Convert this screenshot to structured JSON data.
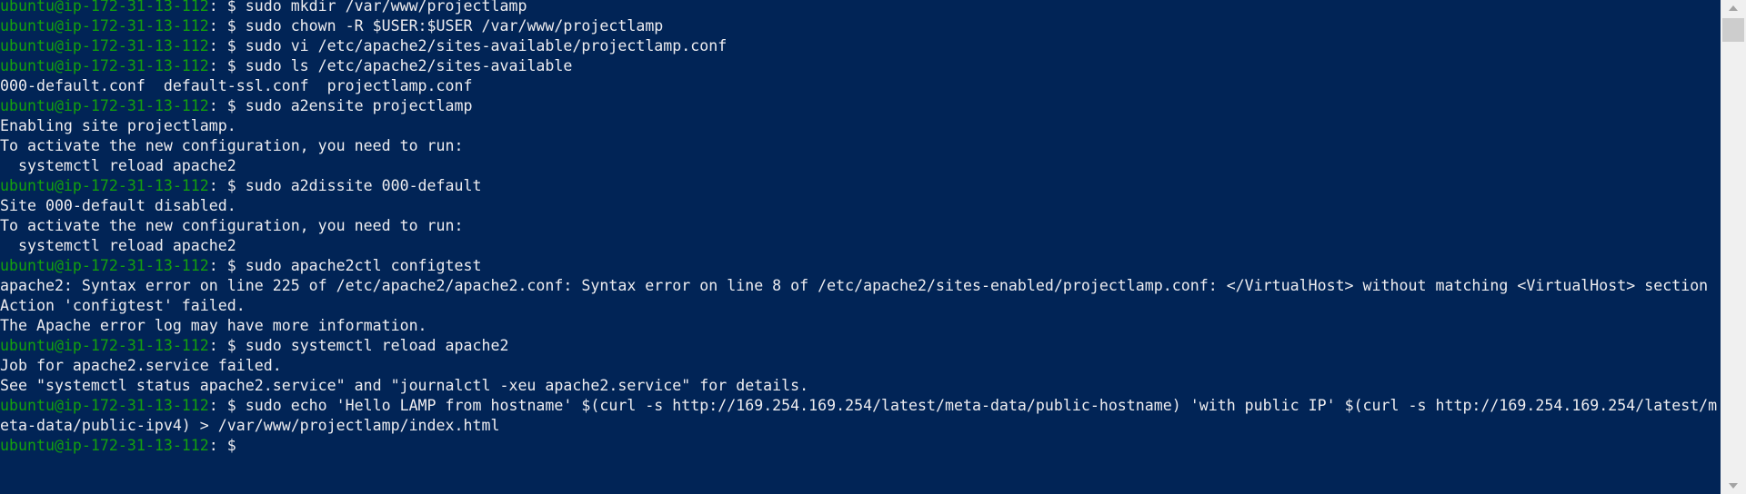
{
  "terminal": {
    "prompt": "ubuntu@ip-172-31-13-112",
    "lines": [
      {
        "type": "cmd",
        "text": ": $ sudo mkdir /var/www/projectlamp"
      },
      {
        "type": "cmd",
        "text": ": $ sudo chown -R $USER:$USER /var/www/projectlamp"
      },
      {
        "type": "cmd",
        "text": ": $ sudo vi /etc/apache2/sites-available/projectlamp.conf"
      },
      {
        "type": "cmd",
        "text": ": $ sudo ls /etc/apache2/sites-available"
      },
      {
        "type": "out",
        "text": "000-default.conf  default-ssl.conf  projectlamp.conf"
      },
      {
        "type": "cmd",
        "text": ": $ sudo a2ensite projectlamp"
      },
      {
        "type": "out",
        "text": "Enabling site projectlamp."
      },
      {
        "type": "out",
        "text": "To activate the new configuration, you need to run:"
      },
      {
        "type": "out",
        "text": "  systemctl reload apache2"
      },
      {
        "type": "cmd",
        "text": ": $ sudo a2dissite 000-default"
      },
      {
        "type": "out",
        "text": "Site 000-default disabled."
      },
      {
        "type": "out",
        "text": "To activate the new configuration, you need to run:"
      },
      {
        "type": "out",
        "text": "  systemctl reload apache2"
      },
      {
        "type": "cmd",
        "text": ": $ sudo apache2ctl configtest"
      },
      {
        "type": "out",
        "text": "apache2: Syntax error on line 225 of /etc/apache2/apache2.conf: Syntax error on line 8 of /etc/apache2/sites-enabled/projectlamp.conf: </VirtualHost> without matching <VirtualHost> section"
      },
      {
        "type": "out",
        "text": "Action 'configtest' failed."
      },
      {
        "type": "out",
        "text": "The Apache error log may have more information."
      },
      {
        "type": "cmd",
        "text": ": $ sudo systemctl reload apache2"
      },
      {
        "type": "out",
        "text": "Job for apache2.service failed."
      },
      {
        "type": "out",
        "text": "See \"systemctl status apache2.service\" and \"journalctl -xeu apache2.service\" for details."
      },
      {
        "type": "cmd",
        "text": ": $ sudo echo 'Hello LAMP from hostname' $(curl -s http://169.254.169.254/latest/meta-data/public-hostname) 'with public IP' $(curl -s http://169.254.169.254/latest/m"
      },
      {
        "type": "out",
        "text": "eta-data/public-ipv4) > /var/www/projectlamp/index.html"
      },
      {
        "type": "cmd",
        "text": ": $ "
      }
    ]
  },
  "colors": {
    "background": "#012456",
    "prompt": "#13a10e",
    "text": "#eeedf0"
  }
}
